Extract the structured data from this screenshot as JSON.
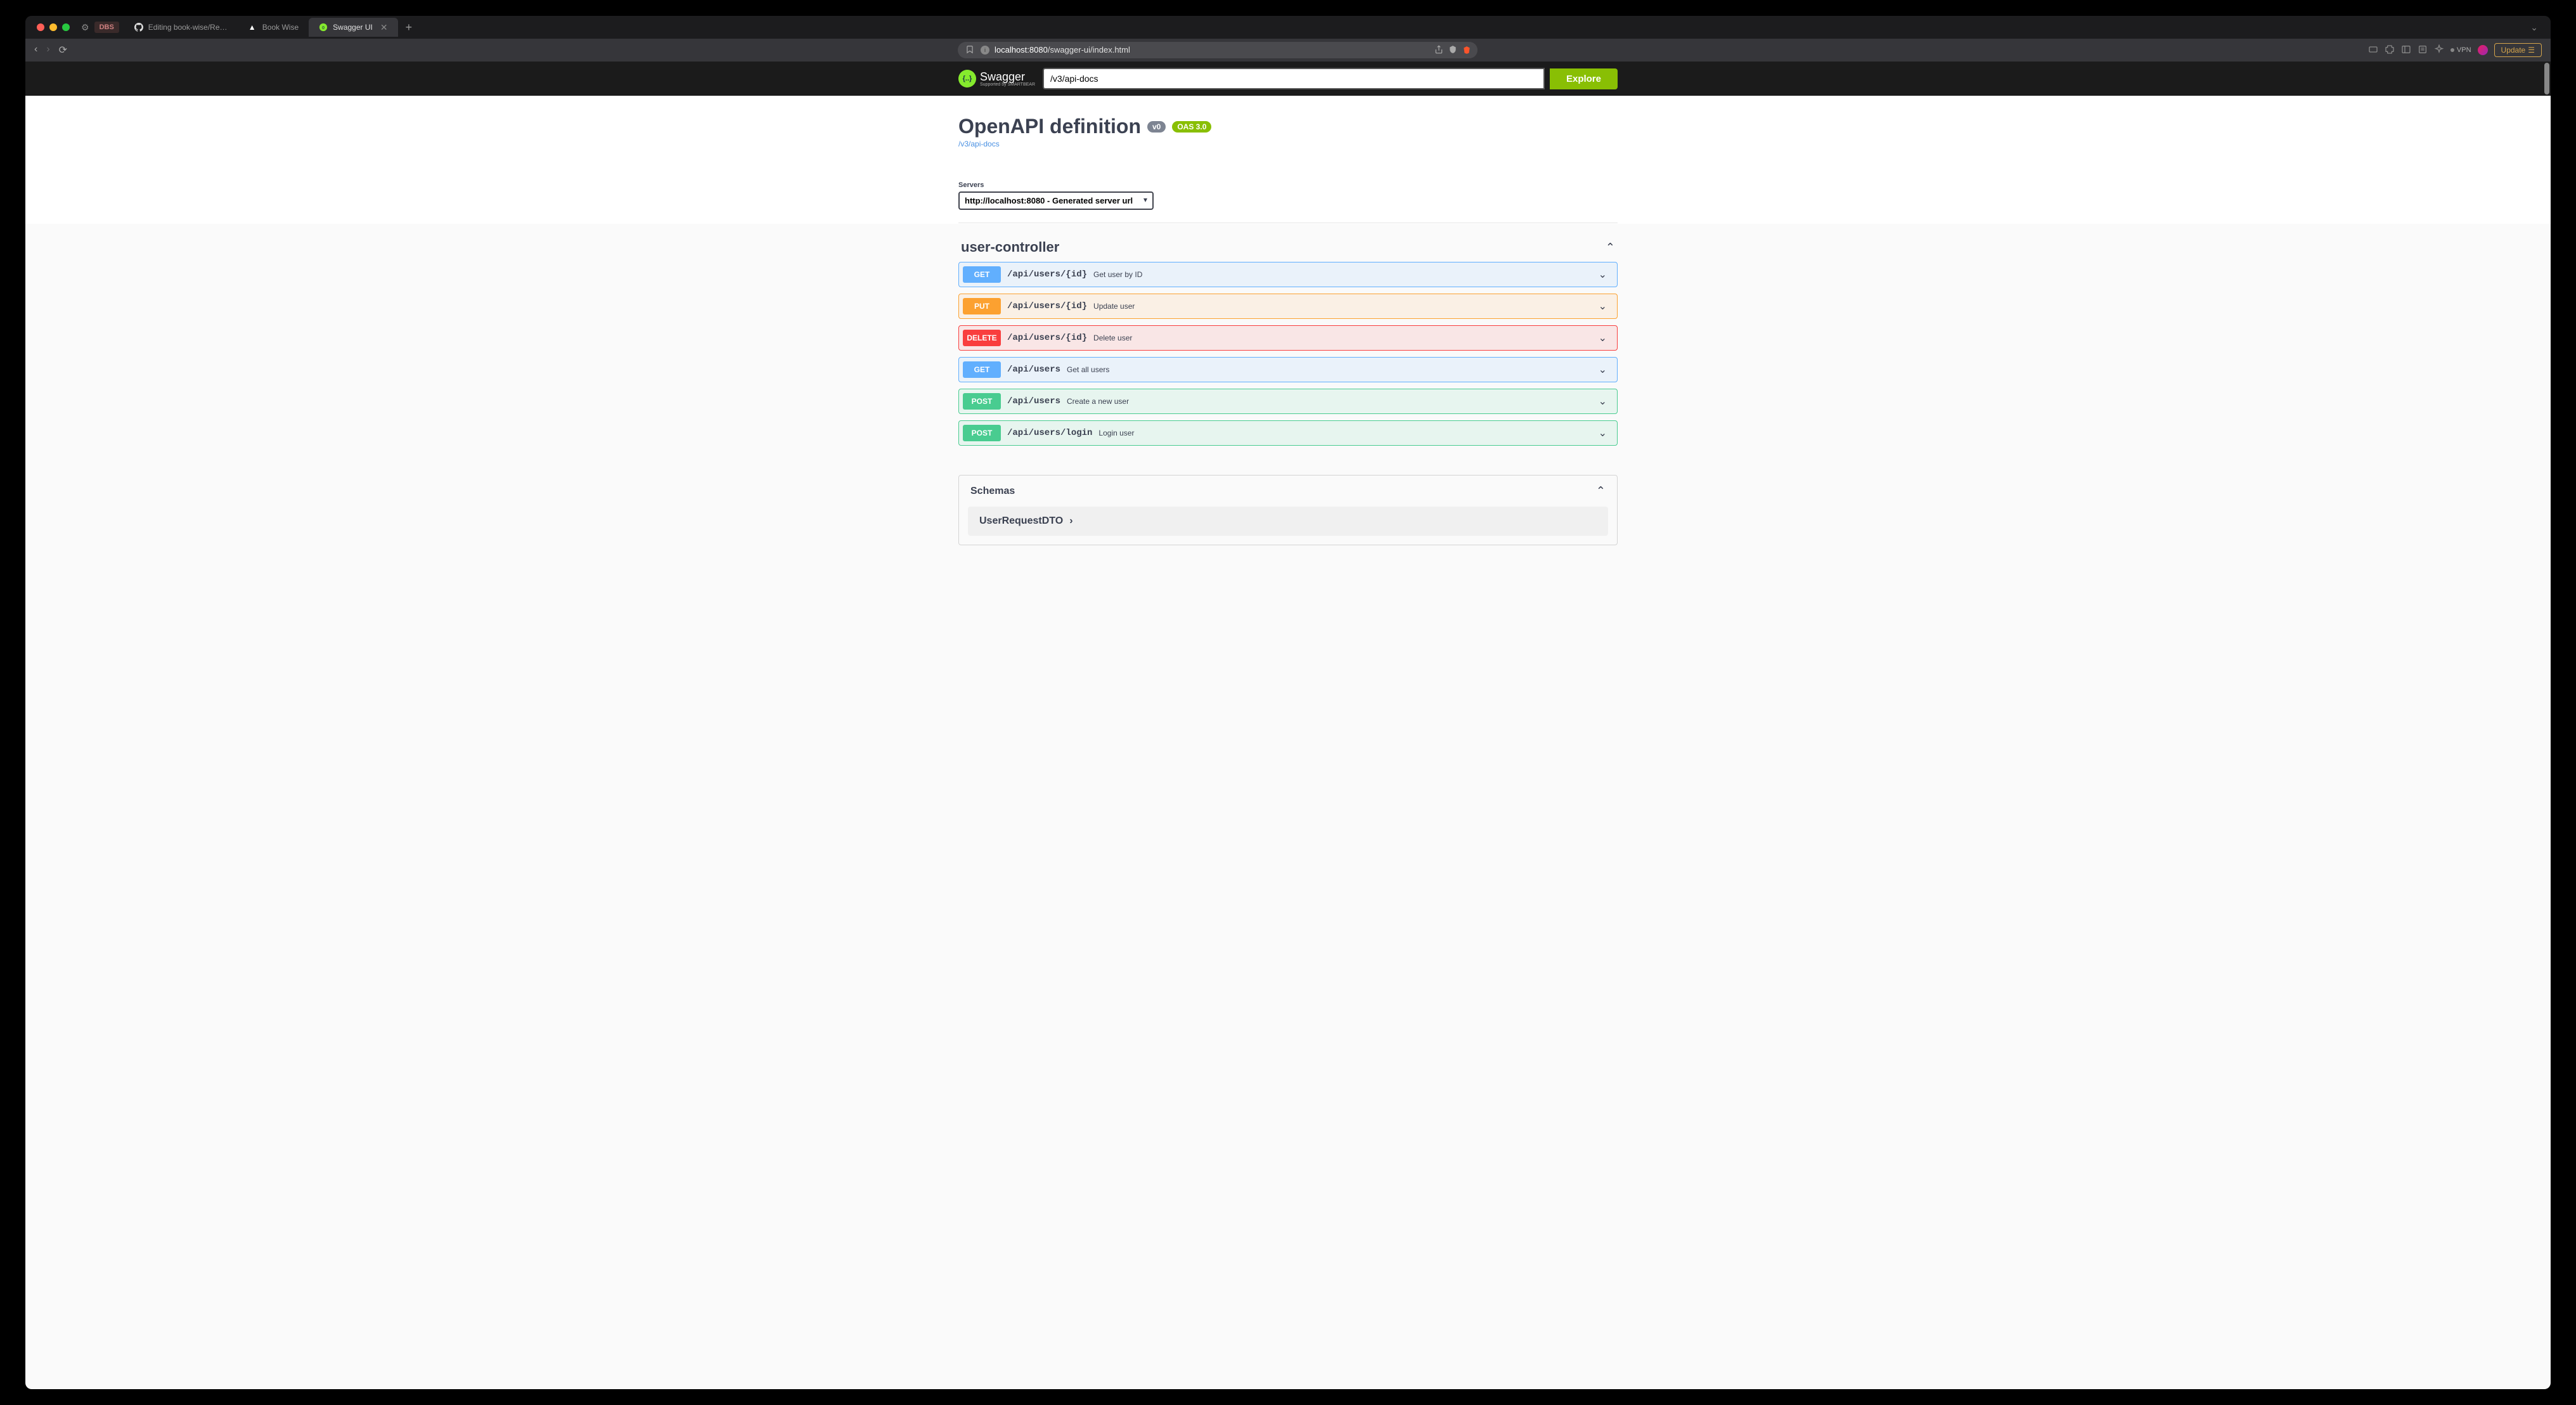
{
  "browser": {
    "tab_extras": {
      "dbs": "DBS"
    },
    "tabs": [
      {
        "icon": "github",
        "label": "Editing book-wise/Readme.md at"
      },
      {
        "icon": "triangle",
        "label": "Book Wise"
      },
      {
        "icon": "swagger",
        "label": "Swagger UI",
        "active": true
      }
    ],
    "url_host": "localhost:8080",
    "url_path": "/swagger-ui/index.html",
    "vpn": "VPN",
    "update": "Update"
  },
  "swagger": {
    "logo_text": "Swagger",
    "logo_sub": "Supported by SMARTBEAR",
    "spec_input": "/v3/api-docs",
    "explore": "Explore",
    "title": "OpenAPI definition",
    "version": "v0",
    "oas": "OAS 3.0",
    "spec_link": "/v3/api-docs",
    "servers_label": "Servers",
    "server_selected": "http://localhost:8080 - Generated server url",
    "tag": "user-controller",
    "operations": [
      {
        "method": "GET",
        "path": "/api/users/{id}",
        "summary": "Get user by ID"
      },
      {
        "method": "PUT",
        "path": "/api/users/{id}",
        "summary": "Update user"
      },
      {
        "method": "DELETE",
        "path": "/api/users/{id}",
        "summary": "Delete user"
      },
      {
        "method": "GET",
        "path": "/api/users",
        "summary": "Get all users"
      },
      {
        "method": "POST",
        "path": "/api/users",
        "summary": "Create a new user"
      },
      {
        "method": "POST",
        "path": "/api/users/login",
        "summary": "Login user"
      }
    ],
    "schemas_title": "Schemas",
    "schemas": [
      {
        "name": "UserRequestDTO"
      }
    ]
  }
}
